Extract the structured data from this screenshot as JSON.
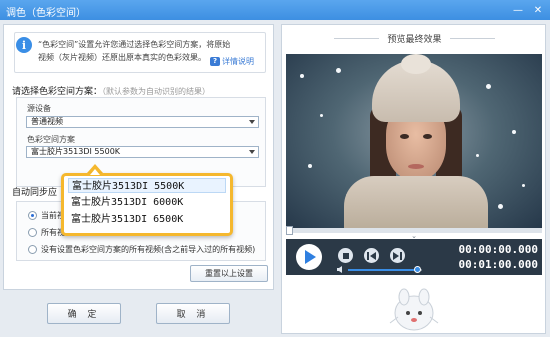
{
  "window": {
    "title": "调色（色彩空间）",
    "min_glyph": "—",
    "close_glyph": "✕"
  },
  "info": {
    "icon_letter": "i",
    "text": "“色彩空间”设置允许您通过选择色彩空间方案，将原始视频（灰片视频）还原出原本真实的色彩效果。",
    "detail_icon": "?",
    "detail_link": "详情说明"
  },
  "scheme": {
    "label": "请选择色彩空间方案：",
    "hint": "（默认参数为自动识别的结果）",
    "source_label": "源设备",
    "source_value": "普通视频",
    "scheme_label": "色彩空间方案",
    "scheme_value": "富士胶片3513DI 5500K"
  },
  "dropdown": {
    "options": [
      "富士胶片3513DI 5500K",
      "富士胶片3513DI 6000K",
      "富士胶片3513DI 6500K"
    ],
    "selected_index": 0
  },
  "apply": {
    "label": "自动同步应",
    "options": [
      "当前视",
      "所有视",
      "没有设置色彩空间方案的所有视频(含之前导入过的所有视频)"
    ],
    "checked_index": 0,
    "reset_label": "重置以上设置"
  },
  "buttons": {
    "ok": "确 定",
    "cancel": "取 消"
  },
  "preview": {
    "title": "预览最终效果",
    "collapse_glyph": "⌄",
    "current_time": "00:00:00.000",
    "total_time": "00:01:00.000",
    "volume": 0.95,
    "progress": 0.0
  },
  "colors": {
    "accent": "#3a8ee6",
    "popup_border": "#f5b82e",
    "title_bar": "#4a9be9"
  },
  "icons": {
    "info": "info-icon",
    "detail": "question-icon",
    "play": "play-icon",
    "stop": "stop-icon",
    "prev": "previous-frame-icon",
    "next": "next-frame-icon",
    "volume": "volume-icon"
  }
}
